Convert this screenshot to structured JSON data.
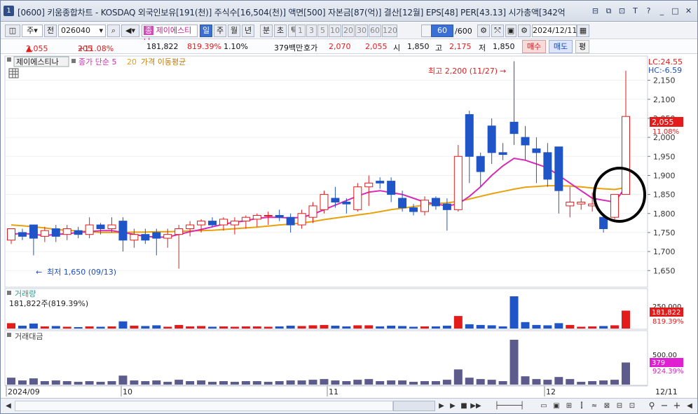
{
  "window": {
    "title": "[0600] 키움종합차트 - KOSDAQ 외국인보유[191(천)] 주식수[16,504(천)] 액면[500] 자본금[87(억)] 결산[12월] EPS[48] PER[43.13] 시가총액[342억",
    "app_icon": "1"
  },
  "toolbar": {
    "period_select": "주",
    "prev_label": "전",
    "code_value": "026040",
    "stock_name": "제이에스티나",
    "stock_badge": "종",
    "periods": [
      "일",
      "주",
      "월",
      "년",
      "분",
      "초",
      "틱"
    ],
    "active_period": "일",
    "intervals": [
      "1",
      "3",
      "5",
      "10",
      "20",
      "30",
      "60",
      "120"
    ],
    "count_value": "60",
    "count_total": "/600",
    "date_value": "2024/12/11"
  },
  "quote": {
    "price": "2,055",
    "change": "205",
    "change_pct": "+11.08%",
    "volume": "181,822",
    "volume_pct": "819.39%",
    "turnover_pct": "1.10%",
    "amount": "379백만",
    "bid_label": "호가",
    "ask_price": "2,070",
    "bid_price": "2,055",
    "open_label": "시",
    "open": "1,850",
    "high_label": "고",
    "high": "2,175",
    "low_label": "저",
    "low": "1,850",
    "buy_label": "매수",
    "sell_label": "매도",
    "eval_label": "평"
  },
  "legend": {
    "name": "제이에스티나",
    "ma5": "종가 단순 5",
    "ma20_num": "20",
    "ma20_text": "가격 이동평균"
  },
  "annotations": {
    "high": "최고 2,200 (11/27)",
    "low": "최저 1,650 (09/13)",
    "lc": "LC:24.55",
    "hc": "HC:-6.59",
    "price_tag": "2,055",
    "price_tag_pct": "11.08%"
  },
  "panels": {
    "volume_title": "거래량",
    "volume_info": "181,822주(819.39%)",
    "volume_axis": "250,000",
    "volume_tag": "181,822",
    "volume_tag_pct": "819.39%",
    "amount_title": "거래대금",
    "amount_axis": "500.00",
    "amount_tag": "379",
    "amount_tag_pct": "924.39%"
  },
  "colors": {
    "up": "#e31b1b",
    "down": "#1f55c7",
    "ma5": "#d62ab7",
    "ma20": "#e8a10c",
    "amount_bar": "#5d5a8c",
    "highlight_circle": "#000000"
  },
  "chart_data": {
    "type": "candlestick",
    "y_ticks": [
      "2,150",
      "2,100",
      "2,050",
      "2,000",
      "1,950",
      "1,900",
      "1,850",
      "1,800",
      "1,750",
      "1,700",
      "1,650"
    ],
    "x_labels": [
      "2024/09",
      "10",
      "11",
      "12",
      "12/11"
    ],
    "ylim": [
      1610,
      2210
    ],
    "candles": [
      {
        "o": 1730,
        "h": 1760,
        "l": 1720,
        "c": 1760,
        "v": 15,
        "a": 10
      },
      {
        "o": 1750,
        "h": 1760,
        "l": 1730,
        "c": 1740,
        "v": 8,
        "a": 6
      },
      {
        "o": 1770,
        "h": 1770,
        "l": 1690,
        "c": 1735,
        "v": 14,
        "a": 9
      },
      {
        "o": 1740,
        "h": 1765,
        "l": 1725,
        "c": 1755,
        "v": 6,
        "a": 5
      },
      {
        "o": 1760,
        "h": 1770,
        "l": 1725,
        "c": 1740,
        "v": 7,
        "a": 6
      },
      {
        "o": 1745,
        "h": 1770,
        "l": 1730,
        "c": 1760,
        "v": 5,
        "a": 5
      },
      {
        "o": 1755,
        "h": 1765,
        "l": 1735,
        "c": 1745,
        "v": 4,
        "a": 4
      },
      {
        "o": 1745,
        "h": 1790,
        "l": 1735,
        "c": 1770,
        "v": 6,
        "a": 5
      },
      {
        "o": 1770,
        "h": 1775,
        "l": 1745,
        "c": 1760,
        "v": 5,
        "a": 4
      },
      {
        "o": 1760,
        "h": 1790,
        "l": 1750,
        "c": 1770,
        "v": 6,
        "a": 5
      },
      {
        "o": 1780,
        "h": 1790,
        "l": 1700,
        "c": 1730,
        "v": 20,
        "a": 13
      },
      {
        "o": 1730,
        "h": 1760,
        "l": 1710,
        "c": 1745,
        "v": 8,
        "a": 6
      },
      {
        "o": 1745,
        "h": 1760,
        "l": 1720,
        "c": 1730,
        "v": 7,
        "a": 5
      },
      {
        "o": 1750,
        "h": 1760,
        "l": 1690,
        "c": 1735,
        "v": 9,
        "a": 6
      },
      {
        "o": 1735,
        "h": 1760,
        "l": 1710,
        "c": 1745,
        "v": 5,
        "a": 4
      },
      {
        "o": 1745,
        "h": 1770,
        "l": 1655,
        "c": 1760,
        "v": 10,
        "a": 7
      },
      {
        "o": 1760,
        "h": 1780,
        "l": 1740,
        "c": 1770,
        "v": 6,
        "a": 5
      },
      {
        "o": 1770,
        "h": 1785,
        "l": 1750,
        "c": 1780,
        "v": 7,
        "a": 6
      },
      {
        "o": 1780,
        "h": 1790,
        "l": 1765,
        "c": 1770,
        "v": 5,
        "a": 4
      },
      {
        "o": 1770,
        "h": 1790,
        "l": 1755,
        "c": 1785,
        "v": 6,
        "a": 5
      },
      {
        "o": 1770,
        "h": 1790,
        "l": 1745,
        "c": 1780,
        "v": 5,
        "a": 4
      },
      {
        "o": 1780,
        "h": 1795,
        "l": 1760,
        "c": 1790,
        "v": 6,
        "a": 5
      },
      {
        "o": 1785,
        "h": 1800,
        "l": 1765,
        "c": 1795,
        "v": 6,
        "a": 5
      },
      {
        "o": 1795,
        "h": 1805,
        "l": 1770,
        "c": 1795,
        "v": 5,
        "a": 4
      },
      {
        "o": 1795,
        "h": 1810,
        "l": 1780,
        "c": 1790,
        "v": 6,
        "a": 5
      },
      {
        "o": 1790,
        "h": 1800,
        "l": 1750,
        "c": 1770,
        "v": 8,
        "a": 6
      },
      {
        "o": 1770,
        "h": 1810,
        "l": 1760,
        "c": 1800,
        "v": 7,
        "a": 6
      },
      {
        "o": 1790,
        "h": 1830,
        "l": 1775,
        "c": 1820,
        "v": 9,
        "a": 7
      },
      {
        "o": 1810,
        "h": 1860,
        "l": 1800,
        "c": 1850,
        "v": 10,
        "a": 8
      },
      {
        "o": 1840,
        "h": 1870,
        "l": 1815,
        "c": 1830,
        "v": 8,
        "a": 6
      },
      {
        "o": 1830,
        "h": 1840,
        "l": 1800,
        "c": 1825,
        "v": 6,
        "a": 5
      },
      {
        "o": 1810,
        "h": 1880,
        "l": 1805,
        "c": 1870,
        "v": 9,
        "a": 7
      },
      {
        "o": 1870,
        "h": 1900,
        "l": 1820,
        "c": 1880,
        "v": 9,
        "a": 8
      },
      {
        "o": 1885,
        "h": 1895,
        "l": 1865,
        "c": 1880,
        "v": 6,
        "a": 5
      },
      {
        "o": 1885,
        "h": 1895,
        "l": 1830,
        "c": 1850,
        "v": 8,
        "a": 6
      },
      {
        "o": 1840,
        "h": 1860,
        "l": 1805,
        "c": 1815,
        "v": 7,
        "a": 6
      },
      {
        "o": 1815,
        "h": 1825,
        "l": 1795,
        "c": 1805,
        "v": 5,
        "a": 4
      },
      {
        "o": 1805,
        "h": 1845,
        "l": 1795,
        "c": 1835,
        "v": 6,
        "a": 5
      },
      {
        "o": 1840,
        "h": 1845,
        "l": 1810,
        "c": 1820,
        "v": 6,
        "a": 5
      },
      {
        "o": 1825,
        "h": 1840,
        "l": 1755,
        "c": 1810,
        "v": 8,
        "a": 7
      },
      {
        "o": 1810,
        "h": 1980,
        "l": 1805,
        "c": 1950,
        "v": 35,
        "a": 22
      },
      {
        "o": 2060,
        "h": 2070,
        "l": 1880,
        "c": 1950,
        "v": 12,
        "a": 10
      },
      {
        "o": 1950,
        "h": 1960,
        "l": 1870,
        "c": 1910,
        "v": 10,
        "a": 8
      },
      {
        "o": 2030,
        "h": 2050,
        "l": 1930,
        "c": 1960,
        "v": 9,
        "a": 7
      },
      {
        "o": 1960,
        "h": 1985,
        "l": 1940,
        "c": 1955,
        "v": 6,
        "a": 5
      },
      {
        "o": 2040,
        "h": 2200,
        "l": 1980,
        "c": 2010,
        "v": 90,
        "a": 65
      },
      {
        "o": 2000,
        "h": 2030,
        "l": 1940,
        "c": 1980,
        "v": 18,
        "a": 12
      },
      {
        "o": 1970,
        "h": 2000,
        "l": 1880,
        "c": 1960,
        "v": 10,
        "a": 8
      },
      {
        "o": 1960,
        "h": 1985,
        "l": 1870,
        "c": 1890,
        "v": 9,
        "a": 7
      },
      {
        "o": 1975,
        "h": 1975,
        "l": 1800,
        "c": 1860,
        "v": 15,
        "a": 11
      },
      {
        "o": 1820,
        "h": 1870,
        "l": 1790,
        "c": 1830,
        "v": 10,
        "a": 8
      },
      {
        "o": 1825,
        "h": 1840,
        "l": 1810,
        "c": 1830,
        "v": 5,
        "a": 4
      },
      {
        "o": 1820,
        "h": 1855,
        "l": 1805,
        "c": 1825,
        "v": 6,
        "a": 5
      },
      {
        "o": 1790,
        "h": 1800,
        "l": 1750,
        "c": 1760,
        "v": 7,
        "a": 6
      },
      {
        "o": 1790,
        "h": 1850,
        "l": 1785,
        "c": 1850,
        "v": 9,
        "a": 7
      },
      {
        "o": 1850,
        "h": 2175,
        "l": 1850,
        "c": 2055,
        "v": 50,
        "a": 32
      }
    ],
    "ma5": [
      1745,
      1748,
      1745,
      1742,
      1745,
      1747,
      1750,
      1752,
      1755,
      1755,
      1750,
      1745,
      1740,
      1738,
      1738,
      1745,
      1752,
      1758,
      1765,
      1772,
      1777,
      1781,
      1787,
      1790,
      1790,
      1788,
      1790,
      1798,
      1810,
      1822,
      1834,
      1846,
      1856,
      1860,
      1855,
      1850,
      1840,
      1830,
      1825,
      1820,
      1825,
      1845,
      1870,
      1900,
      1925,
      1945,
      1940,
      1930,
      1920,
      1900,
      1880,
      1860,
      1840,
      1835,
      1830,
      1870
    ],
    "ma20": [
      1770,
      1768,
      1765,
      1762,
      1758,
      1756,
      1754,
      1752,
      1750,
      1750,
      1750,
      1751,
      1751,
      1752,
      1752,
      1753,
      1754,
      1755,
      1756,
      1758,
      1760,
      1762,
      1764,
      1767,
      1770,
      1772,
      1775,
      1779,
      1784,
      1788,
      1792,
      1796,
      1800,
      1805,
      1810,
      1814,
      1818,
      1822,
      1826,
      1828,
      1832,
      1838,
      1845,
      1852,
      1858,
      1864,
      1869,
      1871,
      1873,
      1873,
      1872,
      1870,
      1867,
      1865,
      1863,
      1868
    ]
  }
}
